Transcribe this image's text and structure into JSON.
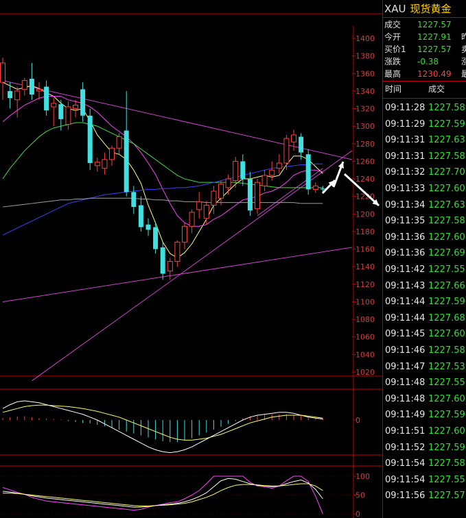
{
  "symbol": {
    "code": "XAU",
    "name": "现货黄金"
  },
  "quote": [
    {
      "label": "成交",
      "value": "1227.57",
      "color": "green",
      "cut": ""
    },
    {
      "label": "今开",
      "value": "1227.91",
      "color": "green",
      "cut": "昨"
    },
    {
      "label": "买价1",
      "value": "1227.57",
      "color": "green",
      "cut": "卖"
    },
    {
      "label": "涨跌",
      "value": "-0.38",
      "color": "green",
      "cut": "涨"
    },
    {
      "label": "最高",
      "value": "1230.49",
      "color": "red",
      "cut": "最"
    }
  ],
  "trades_header": {
    "time": "时间",
    "price": "成交"
  },
  "trades": [
    {
      "time": "09:11:28",
      "price": "1227.58"
    },
    {
      "time": "09:11:29",
      "price": "1227.59"
    },
    {
      "time": "09:11:31",
      "price": "1227.63"
    },
    {
      "time": "09:11:31",
      "price": "1227.58"
    },
    {
      "time": "09:11:32",
      "price": "1227.70"
    },
    {
      "time": "09:11:33",
      "price": "1227.60"
    },
    {
      "time": "09:11:34",
      "price": "1227.63"
    },
    {
      "time": "09:11:35",
      "price": "1227.58"
    },
    {
      "time": "09:11:36",
      "price": "1227.60"
    },
    {
      "time": "09:11:36",
      "price": "1227.69"
    },
    {
      "time": "09:11:42",
      "price": "1227.55"
    },
    {
      "time": "09:11:43",
      "price": "1227.66"
    },
    {
      "time": "09:11:44",
      "price": "1227.59"
    },
    {
      "time": "09:11:44",
      "price": "1227.68"
    },
    {
      "time": "09:11:45",
      "price": "1227.60"
    },
    {
      "time": "09:11:46",
      "price": "1227.58"
    },
    {
      "time": "09:11:47",
      "price": "1227.53"
    },
    {
      "time": "09:11:48",
      "price": "1227.55"
    },
    {
      "time": "09:11:48",
      "price": "1227.60"
    },
    {
      "time": "09:11:49",
      "price": "1227.59"
    },
    {
      "time": "09:11:51",
      "price": "1227.60"
    },
    {
      "time": "09:11:52",
      "price": "1227.59"
    },
    {
      "time": "09:11:54",
      "price": "1227.58"
    },
    {
      "time": "09:11:54",
      "price": "1227.55"
    },
    {
      "time": "09:11:56",
      "price": "1227.57"
    }
  ],
  "chart_data": {
    "type": "candlestick",
    "price_axis": {
      "ticks": [
        1400,
        1380,
        1360,
        1340,
        1320,
        1300,
        1280,
        1260,
        1240,
        1220,
        1200,
        1180,
        1160,
        1140,
        1120,
        1100,
        1080,
        1060,
        1040,
        1020
      ],
      "tick_labels": [
        "1400",
        "1380",
        "1360",
        "1340",
        "1320",
        "1300",
        "1280",
        "1260",
        "1240",
        "1220",
        "1200",
        "1180",
        "1160",
        "1140",
        "1120",
        "1100",
        "1080",
        "1060",
        "1040",
        "1020"
      ],
      "range": [
        1016,
        1410
      ]
    },
    "candles": [
      {
        "o": 1350,
        "h": 1378,
        "c": 1372,
        "l": 1330
      },
      {
        "o": 1340,
        "h": 1350,
        "c": 1332,
        "l": 1320
      },
      {
        "o": 1330,
        "h": 1345,
        "c": 1340,
        "l": 1310
      },
      {
        "o": 1342,
        "h": 1355,
        "c": 1352,
        "l": 1335
      },
      {
        "o": 1354,
        "h": 1372,
        "c": 1336,
        "l": 1330
      },
      {
        "o": 1340,
        "h": 1350,
        "c": 1342,
        "l": 1330
      },
      {
        "o": 1345,
        "h": 1352,
        "c": 1318,
        "l": 1312
      },
      {
        "o": 1322,
        "h": 1332,
        "c": 1326,
        "l": 1300
      },
      {
        "o": 1325,
        "h": 1330,
        "c": 1308,
        "l": 1295
      },
      {
        "o": 1302,
        "h": 1328,
        "c": 1322,
        "l": 1296
      },
      {
        "o": 1320,
        "h": 1330,
        "c": 1324,
        "l": 1310
      },
      {
        "o": 1342,
        "h": 1350,
        "c": 1312,
        "l": 1305
      },
      {
        "o": 1312,
        "h": 1320,
        "c": 1258,
        "l": 1250
      },
      {
        "o": 1255,
        "h": 1264,
        "c": 1259,
        "l": 1248
      },
      {
        "o": 1252,
        "h": 1270,
        "c": 1262,
        "l": 1245
      },
      {
        "o": 1262,
        "h": 1278,
        "c": 1275,
        "l": 1255
      },
      {
        "o": 1275,
        "h": 1292,
        "c": 1288,
        "l": 1268
      },
      {
        "o": 1295,
        "h": 1340,
        "c": 1225,
        "l": 1220
      },
      {
        "o": 1225,
        "h": 1232,
        "c": 1208,
        "l": 1200
      },
      {
        "o": 1210,
        "h": 1220,
        "c": 1185,
        "l": 1180
      },
      {
        "o": 1188,
        "h": 1195,
        "c": 1182,
        "l": 1175
      },
      {
        "o": 1185,
        "h": 1190,
        "c": 1160,
        "l": 1155
      },
      {
        "o": 1162,
        "h": 1168,
        "c": 1132,
        "l": 1125
      },
      {
        "o": 1135,
        "h": 1150,
        "c": 1146,
        "l": 1125
      },
      {
        "o": 1146,
        "h": 1170,
        "c": 1168,
        "l": 1140
      },
      {
        "o": 1168,
        "h": 1190,
        "c": 1186,
        "l": 1160
      },
      {
        "o": 1186,
        "h": 1205,
        "c": 1202,
        "l": 1178
      },
      {
        "o": 1205,
        "h": 1225,
        "c": 1214,
        "l": 1195
      },
      {
        "o": 1195,
        "h": 1215,
        "c": 1210,
        "l": 1188
      },
      {
        "o": 1210,
        "h": 1232,
        "c": 1226,
        "l": 1200
      },
      {
        "o": 1218,
        "h": 1238,
        "c": 1234,
        "l": 1210
      },
      {
        "o": 1230,
        "h": 1245,
        "c": 1240,
        "l": 1222
      },
      {
        "o": 1238,
        "h": 1265,
        "c": 1260,
        "l": 1230
      },
      {
        "o": 1260,
        "h": 1268,
        "c": 1240,
        "l": 1232
      },
      {
        "o": 1240,
        "h": 1248,
        "c": 1204,
        "l": 1198
      },
      {
        "o": 1206,
        "h": 1240,
        "c": 1236,
        "l": 1200
      },
      {
        "o": 1232,
        "h": 1250,
        "c": 1244,
        "l": 1226
      },
      {
        "o": 1244,
        "h": 1260,
        "c": 1250,
        "l": 1238
      },
      {
        "o": 1252,
        "h": 1268,
        "c": 1258,
        "l": 1246
      },
      {
        "o": 1258,
        "h": 1290,
        "c": 1286,
        "l": 1250
      },
      {
        "o": 1282,
        "h": 1296,
        "c": 1290,
        "l": 1272
      },
      {
        "o": 1288,
        "h": 1292,
        "c": 1270,
        "l": 1262
      },
      {
        "o": 1268,
        "h": 1274,
        "c": 1228,
        "l": 1222
      },
      {
        "o": 1228,
        "h": 1236,
        "c": 1232,
        "l": 1224
      },
      {
        "o": 1229,
        "h": 1232,
        "c": 1228,
        "l": 1225
      }
    ],
    "ma_lines": [
      {
        "name": "MA5",
        "color": "#ffff80",
        "values": [
          1350,
          1346,
          1342,
          1344,
          1346,
          1343,
          1338,
          1334,
          1326,
          1320,
          1318,
          1320,
          1306,
          1290,
          1280,
          1270,
          1268,
          1262,
          1250,
          1235,
          1210,
          1190,
          1168,
          1155,
          1150,
          1156,
          1166,
          1180,
          1194,
          1210,
          1218,
          1226,
          1234,
          1240,
          1240,
          1242,
          1244,
          1242,
          1244,
          1256,
          1266,
          1266,
          1262,
          1254,
          1246
        ]
      },
      {
        "name": "MA10",
        "color": "#ff40ff",
        "values": [
          1305,
          1312,
          1318,
          1324,
          1328,
          1332,
          1334,
          1334,
          1334,
          1330,
          1328,
          1326,
          1322,
          1316,
          1308,
          1300,
          1294,
          1288,
          1280,
          1270,
          1258,
          1245,
          1228,
          1212,
          1198,
          1190,
          1186,
          1186,
          1188,
          1194,
          1198,
          1204,
          1210,
          1216,
          1218,
          1220,
          1224,
          1226,
          1230,
          1236,
          1244,
          1248,
          1250,
          1250,
          1248
        ]
      },
      {
        "name": "MA20",
        "color": "#40e040",
        "values": [
          1240,
          1252,
          1262,
          1272,
          1280,
          1288,
          1294,
          1298,
          1300,
          1302,
          1304,
          1304,
          1302,
          1300,
          1296,
          1292,
          1288,
          1284,
          1280,
          1274,
          1268,
          1262,
          1256,
          1250,
          1244,
          1240,
          1238,
          1236,
          1236,
          1236,
          1236,
          1236,
          1236,
          1235,
          1234,
          1233,
          1232,
          1231,
          1230,
          1230,
          1230,
          1230,
          1230,
          1230,
          1230
        ]
      },
      {
        "name": "MA60",
        "color": "#4040ff",
        "values": [
          1176,
          1180,
          1184,
          1188,
          1192,
          1196,
          1200,
          1204,
          1208,
          1212,
          1214,
          1216,
          1218,
          1220,
          1222,
          1223,
          1224,
          1225,
          1226,
          1227,
          1228,
          1228,
          1229,
          1229,
          1230,
          1230,
          1231,
          1232,
          1234,
          1236,
          1238,
          1240,
          1242,
          1244,
          1246,
          1248,
          1250,
          1252,
          1253,
          1254,
          1255,
          1256,
          1256,
          1257,
          1257
        ]
      },
      {
        "name": "MA120",
        "color": "#a0a0a0",
        "values": [
          1208,
          1209,
          1210,
          1211,
          1212,
          1213,
          1214,
          1215,
          1216,
          1216,
          1217,
          1217,
          1218,
          1218,
          1218,
          1218,
          1218,
          1218,
          1218,
          1217,
          1217,
          1216,
          1216,
          1215,
          1215,
          1214,
          1214,
          1214,
          1213,
          1213,
          1213,
          1213,
          1213,
          1213,
          1213,
          1213,
          1213,
          1213,
          1213,
          1213,
          1213,
          1212,
          1212,
          1212,
          1212
        ]
      }
    ],
    "macd_axis": {
      "ticks": [
        0
      ],
      "tick_labels": [
        "0"
      ]
    },
    "macd_hist": [
      0.2,
      0.3,
      0.35,
      0.4,
      0.3,
      0.2,
      0.15,
      0.1,
      0.05,
      -0.1,
      -0.2,
      -0.3,
      -0.35,
      -0.5,
      -0.65,
      -0.8,
      -1,
      -1.2,
      -1.4,
      -1.6,
      -1.8,
      -2,
      -2.2,
      -2.3,
      -2.3,
      -2.1,
      -1.9,
      -1.6,
      -1.3,
      -1,
      -0.7,
      -0.4,
      -0.1,
      0.2,
      0.4,
      0.5,
      0.55,
      0.6,
      0.6,
      0.6,
      0.55,
      0.5,
      0.3,
      0.15,
      0.1
    ],
    "macd_dif": [
      1.2,
      1.6,
      1.9,
      2,
      1.9,
      1.8,
      1.6,
      1.4,
      1.2,
      1,
      0.8,
      0.6,
      0.3,
      0,
      -0.4,
      -0.8,
      -1.2,
      -1.6,
      -2,
      -2.4,
      -2.8,
      -3.1,
      -3.3,
      -3.4,
      -3.3,
      -3.1,
      -2.8,
      -2.4,
      -2,
      -1.6,
      -1.2,
      -0.8,
      -0.4,
      0,
      0.3,
      0.5,
      0.6,
      0.7,
      0.8,
      0.8,
      0.7,
      0.5,
      0.3,
      0.2,
      0.1
    ],
    "macd_dea": [
      0.8,
      1,
      1.2,
      1.4,
      1.5,
      1.55,
      1.55,
      1.5,
      1.45,
      1.4,
      1.3,
      1.2,
      1.05,
      0.9,
      0.7,
      0.5,
      0.3,
      0,
      -0.3,
      -0.6,
      -0.9,
      -1.2,
      -1.5,
      -1.8,
      -2,
      -2.1,
      -2.1,
      -2,
      -1.9,
      -1.7,
      -1.5,
      -1.2,
      -0.9,
      -0.6,
      -0.3,
      -0.1,
      0.1,
      0.3,
      0.4,
      0.5,
      0.5,
      0.5,
      0.4,
      0.3,
      0.2
    ],
    "kdj_axis": {
      "ticks": [
        100,
        50,
        0
      ],
      "tick_labels": [
        "100",
        "50",
        "0"
      ]
    },
    "kdj_k": [
      60,
      58,
      55,
      52,
      48,
      45,
      42,
      40,
      38,
      36,
      34,
      32,
      30,
      28,
      26,
      24,
      22,
      20,
      18,
      18,
      20,
      22,
      24,
      26,
      28,
      32,
      38,
      46,
      56,
      72,
      88,
      94,
      92,
      86,
      80,
      76,
      74,
      72,
      74,
      80,
      86,
      90,
      82,
      65,
      40
    ],
    "kdj_d": [
      55,
      55,
      54,
      52,
      50,
      48,
      46,
      44,
      42,
      40,
      38,
      36,
      34,
      32,
      30,
      28,
      26,
      24,
      22,
      21,
      21,
      22,
      23,
      24,
      26,
      28,
      32,
      38,
      44,
      52,
      62,
      70,
      76,
      78,
      78,
      77,
      75,
      74,
      74,
      76,
      78,
      80,
      80,
      74,
      62
    ],
    "kdj_j": [
      70,
      64,
      57,
      52,
      44,
      39,
      34,
      32,
      30,
      28,
      26,
      24,
      22,
      20,
      18,
      16,
      14,
      12,
      10,
      12,
      18,
      22,
      26,
      30,
      32,
      40,
      50,
      62,
      80,
      100,
      100,
      100,
      100,
      100,
      84,
      74,
      72,
      68,
      74,
      88,
      100,
      100,
      86,
      47,
      0
    ]
  }
}
